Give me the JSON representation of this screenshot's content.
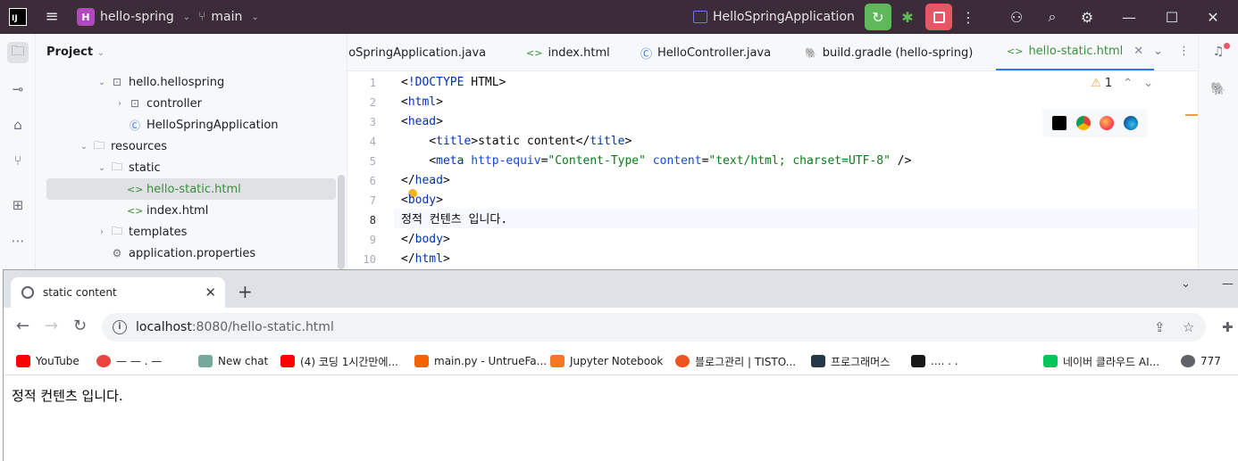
{
  "ide": {
    "project_name": "hello-spring",
    "project_badge": "H",
    "branch": "main",
    "run_config": "HelloSpringApplication",
    "project_panel_title": "Project",
    "tree": [
      {
        "label": "hello.hellospring",
        "indent": 2,
        "expanded": true,
        "type": "package"
      },
      {
        "label": "controller",
        "indent": 3,
        "expanded": false,
        "type": "package"
      },
      {
        "label": "HelloSpringApplication",
        "indent": 3,
        "type": "class"
      },
      {
        "label": "resources",
        "indent": 1,
        "expanded": true,
        "type": "resources"
      },
      {
        "label": "static",
        "indent": 2,
        "expanded": true,
        "type": "folder"
      },
      {
        "label": "hello-static.html",
        "indent": 3,
        "type": "html",
        "selected": true
      },
      {
        "label": "index.html",
        "indent": 3,
        "type": "html"
      },
      {
        "label": "templates",
        "indent": 2,
        "expanded": false,
        "type": "folder"
      },
      {
        "label": "application.properties",
        "indent": 2,
        "type": "properties"
      }
    ],
    "tabs": [
      {
        "label": "lloSpringApplication.java",
        "icon": "class"
      },
      {
        "label": "index.html",
        "icon": "html"
      },
      {
        "label": "HelloController.java",
        "icon": "class"
      },
      {
        "label": "build.gradle (hello-spring)",
        "icon": "gradle"
      },
      {
        "label": "hello-static.html",
        "icon": "html",
        "active": true
      }
    ],
    "warnings_count": "1",
    "current_line": 8,
    "code_lines": [
      "<!DOCTYPE HTML>",
      "<html>",
      "<head>",
      "    <title>static content</title>",
      "    <meta http-equiv=\"Content-Type\" content=\"text/html; charset=UTF-8\" />",
      "</head>",
      "<body>",
      "정적 컨텐츠 입니다.",
      "</body>",
      "</html>"
    ]
  },
  "browser": {
    "tab_title": "static content",
    "url_host": "localhost",
    "url_rest": ":8080/hello-static.html",
    "bookmarks": [
      {
        "label": "YouTube",
        "color": "#ff0000"
      },
      {
        "label": "— — . —",
        "color": "#e8453c"
      },
      {
        "label": "New chat",
        "color": "#74aa9c"
      },
      {
        "label": "(4) 코딩 1시간만에...",
        "color": "#ff0000"
      },
      {
        "label": "main.py - UntrueFa...",
        "color": "#f26207"
      },
      {
        "label": "Jupyter Notebook",
        "color": "#f37726"
      },
      {
        "label": "블로그관리 | TISTO...",
        "color": "#eb531f"
      },
      {
        "label": "프로그래머스",
        "color": "#263747"
      },
      {
        "label": "....  . .",
        "color": "#181717"
      },
      {
        "label": "네이버 클라우드 AI...",
        "color": "#03c75a"
      },
      {
        "label": "777",
        "color": "#5f6368"
      }
    ],
    "page_text": "정적 컨텐츠 입니다."
  }
}
